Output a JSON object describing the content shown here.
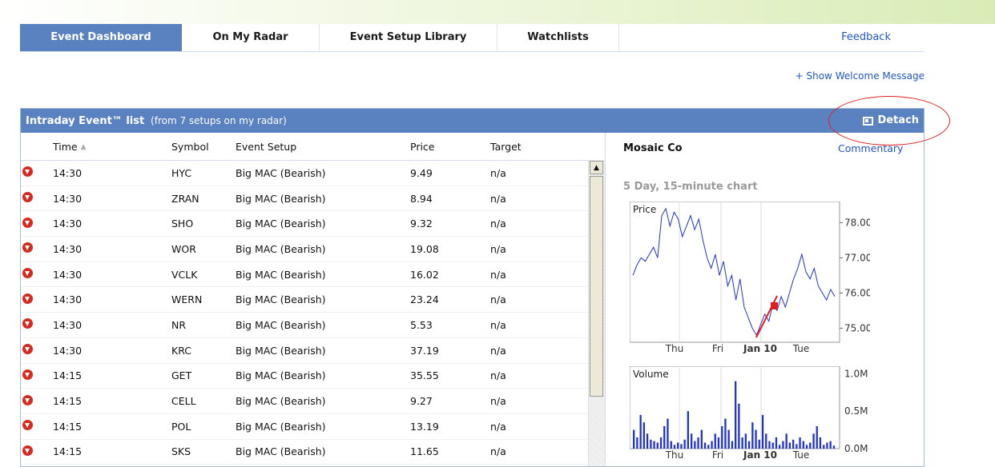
{
  "tabs": [
    {
      "label": "Event Dashboard",
      "active": true
    },
    {
      "label": "On My Radar"
    },
    {
      "label": "Event Setup Library"
    },
    {
      "label": "Watchlists"
    }
  ],
  "feedback_label": "Feedback",
  "welcome_link": "+ Show Welcome Message",
  "panel": {
    "title": "Intraday Event™ list",
    "subtitle": "(from 7 setups on my radar)",
    "detach_label": "Detach"
  },
  "table": {
    "columns": [
      "Time",
      "Symbol",
      "Event Setup",
      "Price",
      "Target"
    ],
    "rows": [
      {
        "time": "14:30",
        "symbol": "HYC",
        "setup": "Big MAC (Bearish)",
        "price": "9.49",
        "target": "n/a"
      },
      {
        "time": "14:30",
        "symbol": "ZRAN",
        "setup": "Big MAC (Bearish)",
        "price": "8.94",
        "target": "n/a"
      },
      {
        "time": "14:30",
        "symbol": "SHO",
        "setup": "Big MAC (Bearish)",
        "price": "9.32",
        "target": "n/a"
      },
      {
        "time": "14:30",
        "symbol": "WOR",
        "setup": "Big MAC (Bearish)",
        "price": "19.08",
        "target": "n/a"
      },
      {
        "time": "14:30",
        "symbol": "VCLK",
        "setup": "Big MAC (Bearish)",
        "price": "16.02",
        "target": "n/a"
      },
      {
        "time": "14:30",
        "symbol": "WERN",
        "setup": "Big MAC (Bearish)",
        "price": "23.24",
        "target": "n/a"
      },
      {
        "time": "14:30",
        "symbol": "NR",
        "setup": "Big MAC (Bearish)",
        "price": "5.53",
        "target": "n/a"
      },
      {
        "time": "14:30",
        "symbol": "KRC",
        "setup": "Big MAC (Bearish)",
        "price": "37.19",
        "target": "n/a"
      },
      {
        "time": "14:15",
        "symbol": "GET",
        "setup": "Big MAC (Bearish)",
        "price": "35.55",
        "target": "n/a"
      },
      {
        "time": "14:15",
        "symbol": "CELL",
        "setup": "Big MAC (Bearish)",
        "price": "9.27",
        "target": "n/a"
      },
      {
        "time": "14:15",
        "symbol": "POL",
        "setup": "Big MAC (Bearish)",
        "price": "13.19",
        "target": "n/a"
      },
      {
        "time": "14:15",
        "symbol": "SKS",
        "setup": "Big MAC (Bearish)",
        "price": "11.65",
        "target": "n/a"
      }
    ]
  },
  "side": {
    "company": "Mosaic Co",
    "commentary_label": "Commentary",
    "chart_title": "5 Day, 15-minute chart",
    "price_label": "Price",
    "volume_label": "Volume",
    "x_ticks": [
      "Thu",
      "Fri",
      "Jan 10",
      "Tue"
    ],
    "price_ticks": [
      "78.00",
      "77.00",
      "76.00",
      "75.00"
    ],
    "volume_ticks": [
      "1.0M",
      "0.5M",
      "0.0M"
    ]
  },
  "colors": {
    "header_blue": "#5a82c0",
    "link_blue": "#2255c4",
    "bearish_red": "#d62a1e",
    "price_line": "#2233cc"
  },
  "icons": {
    "row_icon": "down-arrow-circle-icon",
    "detach_icon": "detach-window-icon",
    "sort_icon": "sort-arrow-icon"
  },
  "chart_data": [
    {
      "type": "line",
      "title": "5 Day, 15-minute chart",
      "ylabel": "Price",
      "x_ticks": [
        "Thu",
        "Fri",
        "Jan 10",
        "Tue"
      ],
      "ylim": [
        74.6,
        78.6
      ],
      "series": [
        {
          "values": [
            76.5,
            76.8,
            77.0,
            76.9,
            77.1,
            77.3,
            77.0,
            78.2,
            78.4,
            77.9,
            78.3,
            78.1,
            77.6,
            77.9,
            78.2,
            77.8,
            78.1,
            77.5,
            77.0,
            76.7,
            77.1,
            76.5,
            76.9,
            76.2,
            76.5,
            75.8,
            76.4,
            75.6,
            75.3,
            75.0,
            74.8,
            75.1,
            75.4,
            75.2,
            75.7,
            75.5,
            75.9,
            75.6,
            76.0,
            76.4,
            76.7,
            77.1,
            76.6,
            76.4,
            76.7,
            76.2,
            76.0,
            75.8,
            76.1,
            75.9
          ]
        }
      ]
    },
    {
      "type": "bar",
      "ylabel": "Volume",
      "x_ticks": [
        "Thu",
        "Fri",
        "Jan 10",
        "Tue"
      ],
      "ylim": [
        0,
        1.1
      ],
      "series": [
        {
          "values": [
            0.25,
            0.15,
            0.45,
            0.35,
            0.2,
            0.12,
            0.1,
            0.08,
            0.15,
            0.3,
            0.4,
            0.1,
            0.05,
            0.08,
            0.06,
            0.12,
            0.5,
            0.2,
            0.1,
            0.15,
            0.25,
            0.08,
            0.05,
            0.1,
            0.2,
            0.15,
            0.3,
            0.4,
            0.25,
            0.1,
            0.9,
            0.6,
            0.15,
            0.2,
            0.1,
            0.35,
            0.25,
            0.12,
            0.45,
            0.2,
            0.1,
            0.08,
            0.15,
            0.05,
            0.1,
            0.2,
            0.08,
            0.12,
            0.06,
            0.15,
            0.1,
            0.05,
            0.08,
            0.2,
            0.3,
            0.15,
            0.05,
            0.08,
            0.1,
            0.04
          ]
        }
      ]
    }
  ]
}
